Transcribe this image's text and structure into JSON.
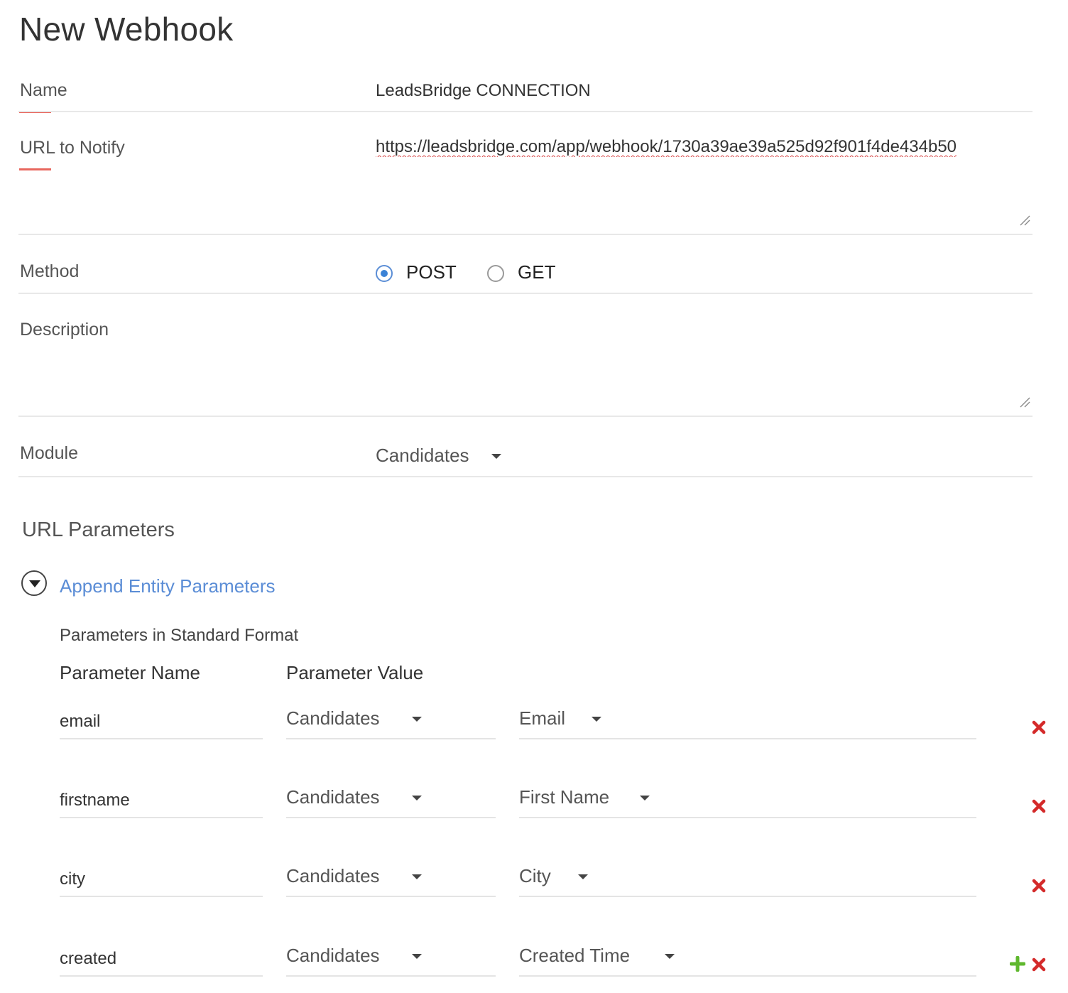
{
  "page": {
    "title": "New Webhook"
  },
  "form": {
    "name": {
      "label": "Name",
      "value": "LeadsBridge CONNECTION"
    },
    "url": {
      "label": "URL to Notify",
      "value": "https://leadsbridge.com/app/webhook/1730a39ae39a525d92f901f4de434b50"
    },
    "method": {
      "label": "Method",
      "options": [
        {
          "label": "POST",
          "checked": true
        },
        {
          "label": "GET",
          "checked": false
        }
      ]
    },
    "description": {
      "label": "Description",
      "value": ""
    },
    "module": {
      "label": "Module",
      "value": "Candidates"
    }
  },
  "url_params": {
    "title": "URL Parameters",
    "append_link": "Append Entity Parameters",
    "standard_format": "Parameters in Standard Format",
    "headers": {
      "name": "Parameter Name",
      "value": "Parameter Value"
    },
    "rows": [
      {
        "name": "email",
        "module": "Candidates",
        "field": "Email"
      },
      {
        "name": "firstname",
        "module": "Candidates",
        "field": "First Name"
      },
      {
        "name": "city",
        "module": "Candidates",
        "field": "City"
      },
      {
        "name": "created",
        "module": "Candidates",
        "field": "Created Time"
      }
    ]
  },
  "icons": {
    "delete": "close-icon",
    "add": "plus-icon",
    "expand": "chevron-down-circle-icon",
    "resize": "resize-grip-icon"
  },
  "colors": {
    "accent_red": "#e8675e",
    "link_blue": "#5b8dd6",
    "radio_blue": "#3b82d6",
    "delete_red": "#d42a2a",
    "add_green": "#5fb82e"
  }
}
